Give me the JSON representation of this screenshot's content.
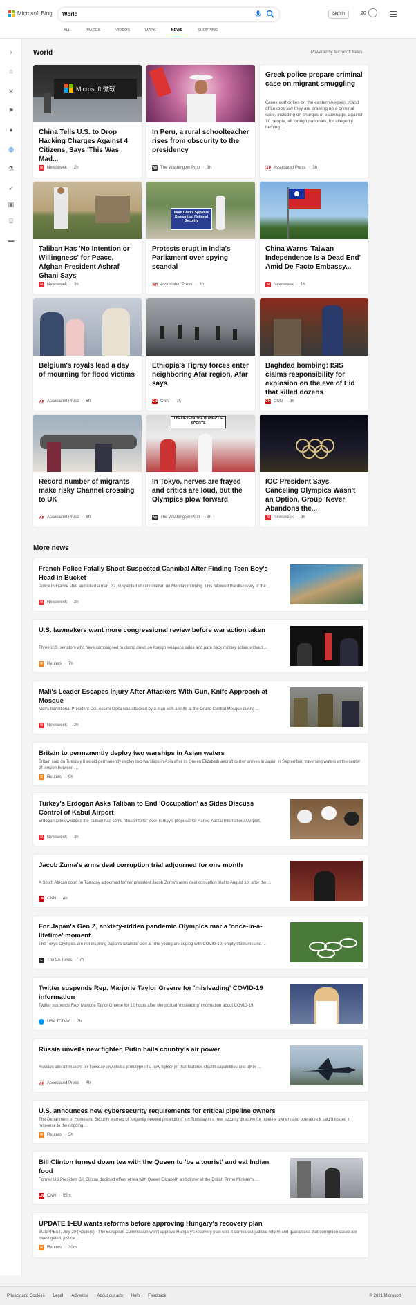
{
  "header": {
    "logo_text": "Microsoft Bing",
    "query": "World",
    "signin_label": "Sign in",
    "points": "20",
    "tabs": [
      "ALL",
      "IMAGES",
      "VIDEOS",
      "MAPS",
      "NEWS",
      "SHOPPING"
    ],
    "active_tab": "NEWS",
    "accent_color": "#1a73e8"
  },
  "rail": {
    "icons": [
      "chevron-right-icon",
      "home-icon",
      "tools-icon",
      "flag-icon",
      "location-icon",
      "globe-icon",
      "microscope-icon",
      "rocket-icon",
      "film-icon",
      "bank-icon",
      "card-icon"
    ]
  },
  "section": {
    "title": "World",
    "powered": "Powered by Microsoft News"
  },
  "cards": [
    {
      "title": "China Tells U.S. to Drop Hacking Charges Against 4 Citizens, Says 'This Was Mad...",
      "source": "Newsweek",
      "time": "2h",
      "src_color": "#e8262d",
      "src_letter": "N"
    },
    {
      "title": "In Peru, a rural schoolteacher rises from obscurity to the presidency",
      "source": "The Washington Post",
      "time": "3h",
      "src_color": "#333333",
      "src_letter": "wp"
    },
    {
      "title": "Greek police prepare criminal case on migrant smuggling",
      "desc": "Greek authorities on the eastern Aegean island of Lesbos say they are drawing up a criminal case, including on charges of espionage, against 10 people, all foreign nationals, for allegedly helping ...",
      "source": "Associated Press",
      "time": "3h",
      "src_color": "#d71920",
      "src_letter": "AP"
    },
    {
      "title": "Taliban Has 'No Intention or Willingness' for Peace, Afghan President Ashraf Ghani Says",
      "source": "Newsweek",
      "time": "3h",
      "src_color": "#e8262d",
      "src_letter": "N"
    },
    {
      "title": "Protests erupt in India's Parliament over spying scandal",
      "source": "Associated Press",
      "time": "3h",
      "src_color": "#d71920",
      "src_letter": "AP"
    },
    {
      "title": "China Warns 'Taiwan Independence Is a Dead End' Amid De Facto Embassy...",
      "source": "Newsweek",
      "time": "1h",
      "src_color": "#e8262d",
      "src_letter": "N"
    },
    {
      "title": "Belgium's royals lead a day of mourning for flood victims",
      "source": "Associated Press",
      "time": "6h",
      "src_color": "#d71920",
      "src_letter": "AP"
    },
    {
      "title": "Ethiopia's Tigray forces enter neighboring Afar region, Afar says",
      "source": "CNN",
      "time": "7h",
      "src_color": "#cc0000",
      "src_letter": "CNN"
    },
    {
      "title": "Baghdad bombing: ISIS claims responsibility for explosion on the eve of Eid that killed dozens",
      "source": "CNN",
      "time": "3h",
      "src_color": "#cc0000",
      "src_letter": "CNN"
    },
    {
      "title": "Record number of migrants make risky Channel crossing to UK",
      "source": "Associated Press",
      "time": "8h",
      "src_color": "#d71920",
      "src_letter": "AP"
    },
    {
      "title": "In Tokyo, nerves are frayed and critics are loud, but the Olympics plow forward",
      "source": "The Washington Post",
      "time": "8h",
      "src_color": "#333333",
      "src_letter": "wp"
    },
    {
      "title": "IOC President Says Canceling Olympics Wasn't an Option, Group 'Never Abandons the...",
      "source": "Newsweek",
      "time": "3h",
      "src_color": "#e8262d",
      "src_letter": "N"
    }
  ],
  "card_images": {
    "microsoft_sign": "Microsoft 微软",
    "taiwan_placard": "Modi Govt's Spyware Dismantled National Security",
    "tokyo_placard": "I BELIEVE IN THE POWER OF SPORTS"
  },
  "more_news": {
    "title": "More news",
    "items": [
      {
        "title": "French Police Fatally Shoot Suspected Cannibal After Finding Teen Boy's Head in Bucket",
        "desc": "Police in France shot and killed a man, 32, suspected of cannibalism on Monday morning. This followed the discovery of the ...",
        "source": "Newsweek",
        "time": "2h",
        "src_color": "#e8262d",
        "src_letter": "N"
      },
      {
        "title": "U.S. lawmakers want more congressional review before war action taken",
        "desc": "Three U.S. senators who have campaigned to clamp down on foreign weapons sales and pare back military action without ...",
        "source": "Reuters",
        "time": "7h",
        "src_color": "#f58220",
        "src_letter": "R"
      },
      {
        "title": "Mali's Leader Escapes Injury After Attackers With Gun, Knife Approach at Mosque",
        "desc": "Mali's transitional President Col. Assimi Goita was attacked by a man with a knife at the Grand Central Mosque during ...",
        "source": "Newsweek",
        "time": "2h",
        "src_color": "#e8262d",
        "src_letter": "N"
      },
      {
        "title": "Britain to permanently deploy two warships in Asian waters",
        "desc": "Britain said on Tuesday it would permanently deploy two warships in Asia after its Queen Elizabeth aircraft carrier arrives in Japan in September, traversing waters at the center of tension between ...",
        "source": "Reuters",
        "time": "9h",
        "src_color": "#f58220",
        "src_letter": "R"
      },
      {
        "title": "Turkey's Erdogan Asks Taliban to End 'Occupation' as Sides Discuss Control of Kabul Airport",
        "desc": "Erdogan acknowledged the Taliban had some \"discomforts\" over Turkey's proposal for Hamid Karzai International Airport.",
        "source": "Newsweek",
        "time": "3h",
        "src_color": "#e8262d",
        "src_letter": "N"
      },
      {
        "title": "Jacob Zuma's arms deal corruption trial adjourned for one month",
        "desc": "A South African court on Tuesday adjourned former president Jacob Zuma's arms deal corruption trial to August 10, after the ...",
        "source": "CNN",
        "time": "8h",
        "src_color": "#cc0000",
        "src_letter": "CNN"
      },
      {
        "title": "For Japan's Gen Z, anxiety-ridden pandemic Olympics mar a 'once-in-a-lifetime' moment",
        "desc": "The Tokyo Olympics are not inspiring Japan's fatalistic Gen Z. The young are coping with COVID-19, empty stadiums and ...",
        "source": "The LA Times",
        "time": "7h",
        "src_color": "#222222",
        "src_letter": "L"
      },
      {
        "title": "Twitter suspends Rep. Marjorie Taylor Greene for 'misleading' COVID-19 information",
        "desc": "Twitter suspends Rep. Marjorie Taylor Greene for 12 hours after she posted 'misleading' information about COVID-19.",
        "source": "USA TODAY",
        "time": "3h",
        "src_color": "#009bff",
        "src_letter": ""
      },
      {
        "title": "Russia unveils new fighter, Putin hails country's air power",
        "desc": "Russian aircraft makers on Tuesday unveiled a prototype of a new fighter jet that features stealth capabilities and other ...",
        "source": "Associated Press",
        "time": "4h",
        "src_color": "#d71920",
        "src_letter": "AP"
      },
      {
        "title": "U.S. announces new cybersecurity requirements for critical pipeline owners",
        "desc": "The Department of Homeland Security warned of \"urgently needed protections\" on Tuesday in a new security directive for pipeline owners and operators it said it issued in response to the ongoing ...",
        "source": "Reuters",
        "time": "5h",
        "src_color": "#f58220",
        "src_letter": "R"
      },
      {
        "title": "Bill Clinton turned down tea with the Queen to 'be a tourist' and eat Indian food",
        "desc": "Former US President Bill Clinton declined offers of tea with Queen Elizabeth and dinner at the British Prime Minister's ...",
        "source": "CNN",
        "time": "55m",
        "src_color": "#cc0000",
        "src_letter": "CNN"
      },
      {
        "title": "UPDATE 1-EU wants reforms before approving Hungary's recovery plan",
        "desc": "BUDAPEST, July 20 (Reuters) - The European Commission won't approve Hungary's recovery plan until it carries out judicial reform and guarantees that corruption cases are investigated, justice ...",
        "source": "Reuters",
        "time": "30m",
        "src_color": "#f58220",
        "src_letter": "R"
      }
    ]
  },
  "footer": {
    "links": [
      "Privacy and Cookies",
      "Legal",
      "Advertise",
      "About our ads",
      "Help",
      "Feedback"
    ],
    "copyright": "© 2021 Microsoft"
  }
}
